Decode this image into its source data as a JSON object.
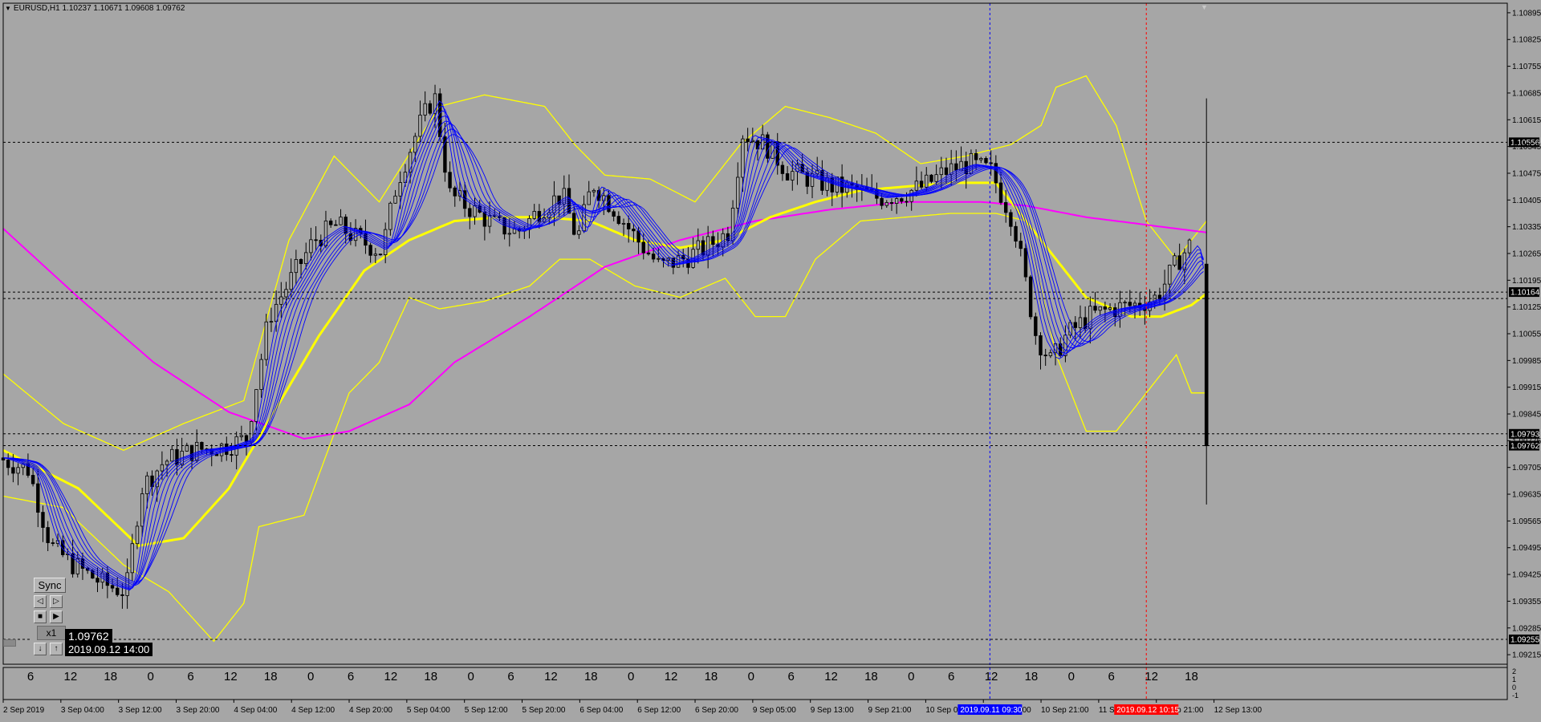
{
  "title": "EURUSD,H1  1.10237 1.10671 1.09608 1.09762",
  "price_scale": {
    "labels": [
      "1.10895",
      "1.10825",
      "1.10755",
      "1.10685",
      "1.10615",
      "1.10545",
      "1.10475",
      "1.10405",
      "1.10335",
      "1.10265",
      "1.10195",
      "1.10125",
      "1.10055",
      "1.09985",
      "1.09915",
      "1.09845",
      "1.09775",
      "1.09705",
      "1.09635",
      "1.09565",
      "1.09495",
      "1.09425",
      "1.09355",
      "1.09285",
      "1.09215"
    ],
    "range": [
      1.0919,
      1.1092
    ]
  },
  "hlines": [
    {
      "price": 1.10556,
      "label": "1.10556"
    },
    {
      "price": 1.10164,
      "label": "1.10164"
    },
    {
      "price": 1.10147,
      "label": ""
    },
    {
      "price": 1.09793,
      "label": "1.09793"
    },
    {
      "price": 1.09762,
      "label": "1.09762"
    },
    {
      "price": 1.09255,
      "label": "1.09255"
    }
  ],
  "vlines": [
    {
      "x_label": "2019.09.11 09:30",
      "color": "#0000ff"
    },
    {
      "x_label": "2019.09.12 10:15",
      "color": "#ff0000"
    }
  ],
  "indicator": {
    "hour_labels": [
      "6",
      "12",
      "18",
      "0",
      "6",
      "12",
      "18",
      "0",
      "6",
      "12",
      "18",
      "0",
      "6",
      "12",
      "18",
      "0",
      "12",
      "18",
      "0",
      "6",
      "12",
      "18",
      "0",
      "6",
      "12",
      "18",
      "0",
      "6",
      "12",
      "18"
    ],
    "scale_labels": [
      "2",
      "1",
      "0",
      "-1"
    ]
  },
  "time_labels": [
    "2 Sep 2019",
    "3 Sep 04:00",
    "3 Sep 12:00",
    "3 Sep 20:00",
    "4 Sep 04:00",
    "4 Sep 12:00",
    "4 Sep 20:00",
    "5 Sep 04:00",
    "5 Sep 12:00",
    "5 Sep 20:00",
    "6 Sep 04:00",
    "6 Sep 12:00",
    "6 Sep 20:00",
    "9 Sep 05:00",
    "9 Sep 13:00",
    "9 Sep 21:00",
    "10 Sep 05:00",
    "10 Sep 13:00",
    "10 Sep 21:00",
    "11 Sep 13:00",
    "11 Sep 21:00",
    "12 Sep 13:00"
  ],
  "time_badges": [
    {
      "label": "2019.09.11 09:30",
      "color": "#0000ff"
    },
    {
      "label": "2019.09.12 10:15",
      "color": "#ff0000"
    }
  ],
  "sync_panel": {
    "sync_label": "Sync",
    "step_back_icon": "step-back-icon",
    "step_forward_icon": "step-forward-icon",
    "stop_icon": "stop-icon",
    "play_icon": "play-icon",
    "speed_label": "x1",
    "down_icon": "arrow-down-icon",
    "up_icon": "arrow-up-icon",
    "price": "1.09762",
    "time": "2019.09.12 14:00"
  },
  "colors": {
    "background": "#a6a6a6",
    "candle": "#000000",
    "ribbon": "#0000ff",
    "bands": "#ffff00",
    "ma_long": "#ff00ff",
    "grid_dash": "#000000"
  },
  "chart_data": {
    "type": "candlestick",
    "symbol": "EURUSD",
    "timeframe": "H1",
    "last_bar": {
      "open": 1.10237,
      "high": 1.10671,
      "low": 1.09608,
      "close": 1.09762
    },
    "ylim": [
      1.0919,
      1.1092
    ],
    "close_path": [
      [
        0,
        1.0973
      ],
      [
        0.02,
        1.097
      ],
      [
        0.035,
        1.095
      ],
      [
        0.05,
        1.0945
      ],
      [
        0.07,
        1.094
      ],
      [
        0.085,
        1.0938
      ],
      [
        0.095,
        1.0965
      ],
      [
        0.11,
        1.0972
      ],
      [
        0.13,
        1.0975
      ],
      [
        0.15,
        1.0976
      ],
      [
        0.165,
        1.0978
      ],
      [
        0.18,
        1.101
      ],
      [
        0.195,
        1.102
      ],
      [
        0.21,
        1.103
      ],
      [
        0.225,
        1.1034
      ],
      [
        0.24,
        1.103
      ],
      [
        0.255,
        1.1027
      ],
      [
        0.265,
        1.1045
      ],
      [
        0.28,
        1.106
      ],
      [
        0.29,
        1.1068
      ],
      [
        0.3,
        1.1042
      ],
      [
        0.315,
        1.1038
      ],
      [
        0.33,
        1.1034
      ],
      [
        0.345,
        1.1032
      ],
      [
        0.36,
        1.1038
      ],
      [
        0.375,
        1.1042
      ],
      [
        0.385,
        1.103
      ],
      [
        0.395,
        1.1045
      ],
      [
        0.41,
        1.1038
      ],
      [
        0.425,
        1.103
      ],
      [
        0.44,
        1.1023
      ],
      [
        0.455,
        1.1025
      ],
      [
        0.47,
        1.1028
      ],
      [
        0.485,
        1.1032
      ],
      [
        0.495,
        1.1058
      ],
      [
        0.51,
        1.1055
      ],
      [
        0.525,
        1.1048
      ],
      [
        0.54,
        1.1046
      ],
      [
        0.555,
        1.1044
      ],
      [
        0.57,
        1.1043
      ],
      [
        0.585,
        1.1041
      ],
      [
        0.6,
        1.1042
      ],
      [
        0.615,
        1.1044
      ],
      [
        0.63,
        1.1048
      ],
      [
        0.645,
        1.105
      ],
      [
        0.66,
        1.1048
      ],
      [
        0.675,
        1.1035
      ],
      [
        0.69,
        1.1005
      ],
      [
        0.7,
        1.0998
      ],
      [
        0.71,
        1.1005
      ],
      [
        0.725,
        1.101
      ],
      [
        0.74,
        1.1012
      ],
      [
        0.755,
        1.1013
      ],
      [
        0.77,
        1.1015
      ],
      [
        0.785,
        1.1025
      ],
      [
        0.795,
        1.103
      ],
      [
        0.805,
        1.0976
      ]
    ],
    "ma_long_path": [
      [
        0,
        1.1033
      ],
      [
        0.05,
        1.1015
      ],
      [
        0.1,
        1.0998
      ],
      [
        0.15,
        1.0985
      ],
      [
        0.2,
        1.0978
      ],
      [
        0.23,
        1.098
      ],
      [
        0.27,
        1.0987
      ],
      [
        0.3,
        1.0998
      ],
      [
        0.35,
        1.101
      ],
      [
        0.4,
        1.1023
      ],
      [
        0.45,
        1.103
      ],
      [
        0.5,
        1.1035
      ],
      [
        0.55,
        1.1038
      ],
      [
        0.6,
        1.104
      ],
      [
        0.65,
        1.104
      ],
      [
        0.68,
        1.1039
      ],
      [
        0.72,
        1.1036
      ],
      [
        0.76,
        1.1034
      ],
      [
        0.8,
        1.1032
      ]
    ],
    "ma_mid_path": [
      [
        0,
        1.0975
      ],
      [
        0.05,
        1.0965
      ],
      [
        0.09,
        1.095
      ],
      [
        0.12,
        1.0952
      ],
      [
        0.15,
        1.0965
      ],
      [
        0.18,
        1.0985
      ],
      [
        0.21,
        1.1005
      ],
      [
        0.24,
        1.1022
      ],
      [
        0.27,
        1.103
      ],
      [
        0.3,
        1.1035
      ],
      [
        0.33,
        1.1036
      ],
      [
        0.36,
        1.1036
      ],
      [
        0.39,
        1.1035
      ],
      [
        0.42,
        1.103
      ],
      [
        0.45,
        1.1028
      ],
      [
        0.48,
        1.103
      ],
      [
        0.51,
        1.1036
      ],
      [
        0.54,
        1.104
      ],
      [
        0.57,
        1.1043
      ],
      [
        0.6,
        1.1044
      ],
      [
        0.63,
        1.1045
      ],
      [
        0.66,
        1.1045
      ],
      [
        0.69,
        1.103
      ],
      [
        0.72,
        1.1015
      ],
      [
        0.75,
        1.101
      ],
      [
        0.77,
        1.101
      ],
      [
        0.79,
        1.1013
      ],
      [
        0.8,
        1.1016
      ]
    ],
    "band_upper_path": [
      [
        0,
        1.0995
      ],
      [
        0.04,
        1.0982
      ],
      [
        0.08,
        1.0975
      ],
      [
        0.12,
        1.0982
      ],
      [
        0.16,
        1.0988
      ],
      [
        0.19,
        1.103
      ],
      [
        0.22,
        1.1052
      ],
      [
        0.25,
        1.104
      ],
      [
        0.29,
        1.1065
      ],
      [
        0.32,
        1.1068
      ],
      [
        0.36,
        1.1065
      ],
      [
        0.38,
        1.1055
      ],
      [
        0.4,
        1.1047
      ],
      [
        0.43,
        1.1046
      ],
      [
        0.46,
        1.104
      ],
      [
        0.49,
        1.1055
      ],
      [
        0.52,
        1.1065
      ],
      [
        0.55,
        1.1062
      ],
      [
        0.58,
        1.1058
      ],
      [
        0.61,
        1.105
      ],
      [
        0.64,
        1.1052
      ],
      [
        0.67,
        1.1055
      ],
      [
        0.69,
        1.106
      ],
      [
        0.7,
        1.107
      ],
      [
        0.72,
        1.1073
      ],
      [
        0.74,
        1.106
      ],
      [
        0.76,
        1.1035
      ],
      [
        0.78,
        1.1025
      ],
      [
        0.8,
        1.1035
      ]
    ],
    "band_lower_path": [
      [
        0,
        1.0963
      ],
      [
        0.04,
        1.096
      ],
      [
        0.08,
        1.0945
      ],
      [
        0.11,
        1.0938
      ],
      [
        0.14,
        1.0925
      ],
      [
        0.16,
        1.0935
      ],
      [
        0.17,
        1.0955
      ],
      [
        0.2,
        1.0958
      ],
      [
        0.23,
        1.099
      ],
      [
        0.25,
        1.0998
      ],
      [
        0.27,
        1.1015
      ],
      [
        0.29,
        1.1012
      ],
      [
        0.32,
        1.1014
      ],
      [
        0.35,
        1.1018
      ],
      [
        0.37,
        1.1025
      ],
      [
        0.39,
        1.1025
      ],
      [
        0.42,
        1.1018
      ],
      [
        0.45,
        1.1015
      ],
      [
        0.48,
        1.102
      ],
      [
        0.5,
        1.101
      ],
      [
        0.52,
        1.101
      ],
      [
        0.54,
        1.1025
      ],
      [
        0.57,
        1.1035
      ],
      [
        0.6,
        1.1036
      ],
      [
        0.63,
        1.1037
      ],
      [
        0.66,
        1.1037
      ],
      [
        0.68,
        1.1035
      ],
      [
        0.7,
        1.1
      ],
      [
        0.72,
        1.098
      ],
      [
        0.74,
        1.098
      ],
      [
        0.76,
        1.099
      ],
      [
        0.78,
        1.1
      ],
      [
        0.79,
        1.099
      ],
      [
        0.8,
        1.099
      ]
    ]
  }
}
